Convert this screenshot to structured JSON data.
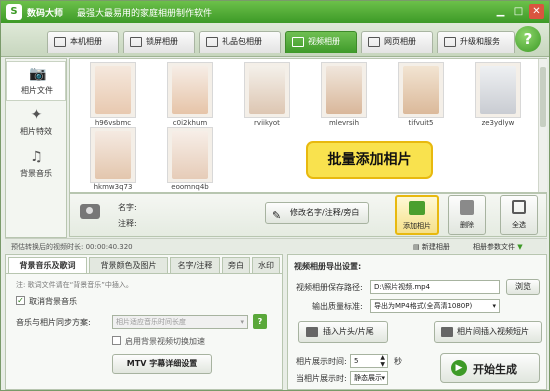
{
  "titlebar": {
    "app_name": "数码大师",
    "subtitle": "最强大最易用的家庭相册制作软件"
  },
  "nav": {
    "tabs": [
      "本机相册",
      "锁屏相册",
      "礼品包相册",
      "视频相册",
      "网页相册",
      "升级和服务"
    ],
    "active": "视频相册",
    "help": "?"
  },
  "sidebar": {
    "items": [
      "相片文件",
      "相片特效",
      "背景音乐"
    ]
  },
  "photos": [
    {
      "name": "h96vsbmc"
    },
    {
      "name": "c0i2khum"
    },
    {
      "name": "rviikyot"
    },
    {
      "name": "mlevrsih"
    },
    {
      "name": "tifvuit5"
    },
    {
      "name": "ze3ydlyw"
    },
    {
      "name": "hkmw3q73"
    },
    {
      "name": "eoomnq4b"
    }
  ],
  "tooltip": "批量添加相片",
  "info": {
    "name_label": "名字:",
    "note_label": "注释:",
    "edit_button": "修改名字/注释/旁白",
    "add_button": "添加相片",
    "delete_button": "删除",
    "select_all_button": "全选"
  },
  "status": {
    "duration": "预估转换后的视频时长: 00:00:40.320",
    "new_album": "新建相册",
    "param_file": "相册参数文件"
  },
  "left_panel": {
    "tabs": [
      "背景音乐及歌词",
      "背景颜色及图片",
      "名字/注释",
      "旁白",
      "水印"
    ],
    "hint": "注: 歌词文件请在“背景音乐”中插入。",
    "cancel_music_label": "取消背景音乐",
    "sync_label": "音乐与相片同步方案:",
    "sync_value": "相片适应音乐时间长度",
    "sync_help": "?",
    "switch_anim_label": "启用背景视频切换加速",
    "lyrics_button": "MTV 字幕详细设置"
  },
  "right_panel": {
    "title": "视频相册导出设置:",
    "path_label": "视频相册保存路径:",
    "path_value": "D:\\照片视频.mp4",
    "browse_button": "浏览",
    "quality_label": "输出质量标准:",
    "quality_value": "导出为MP4格式(全高清1080P)",
    "insert_head_button": "插入片头/片尾",
    "insert_between_button": "相片间插入视频短片",
    "photo_time_label": "相片展示时间:",
    "photo_time_value": "5",
    "photo_time_unit": "秒",
    "display_mode_label": "当相片展示时:",
    "display_mode_value": "静态展示",
    "start_button": "开始生成"
  }
}
